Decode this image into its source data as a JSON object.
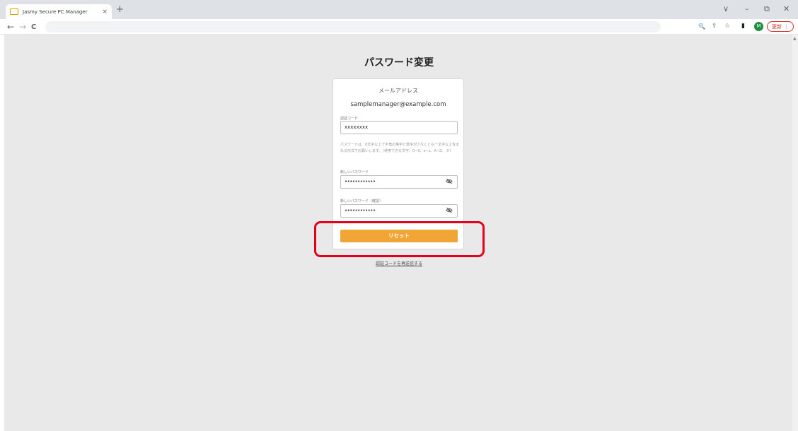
{
  "browser": {
    "tab_title": "Jasmy Secure PC Manager",
    "tab_close": "×",
    "new_tab": "+",
    "window": {
      "dropdown": "∨",
      "minimize": "–",
      "restore": "⧉",
      "close": "✕"
    },
    "nav": {
      "back": "←",
      "forward": "→",
      "reload": "C"
    },
    "toolbar_icons": {
      "zoom": "🔍",
      "share": "⇪",
      "bookmark": "☆",
      "sidepanel": "▮"
    },
    "avatar_initial": "M",
    "update_label": "更新",
    "update_menu": "⋮"
  },
  "page": {
    "title": "パスワード変更",
    "email_label": "メールアドレス",
    "email_value": "samplemanager@example.com",
    "code_label": "認証コード",
    "code_value": "xxxxxxxx",
    "hint_text": "パスワードは、8文字以上で半角の英字と数字が少なくとも一文字以上含まれる形式でお願いします。（使用できる文字、0~9、a~z、A~Z、.?!）",
    "new_password_label": "新しいパスワード",
    "new_password_value": "••••••••••••",
    "confirm_password_label": "新しいパスワード（確認）",
    "confirm_password_value": "••••••••••••",
    "reset_button": "リセット",
    "resend_link": "認証コードを再送信する"
  },
  "colors": {
    "reset_button": "#f0a534",
    "highlight": "#e4001b",
    "page_background": "#e9e9e9"
  }
}
